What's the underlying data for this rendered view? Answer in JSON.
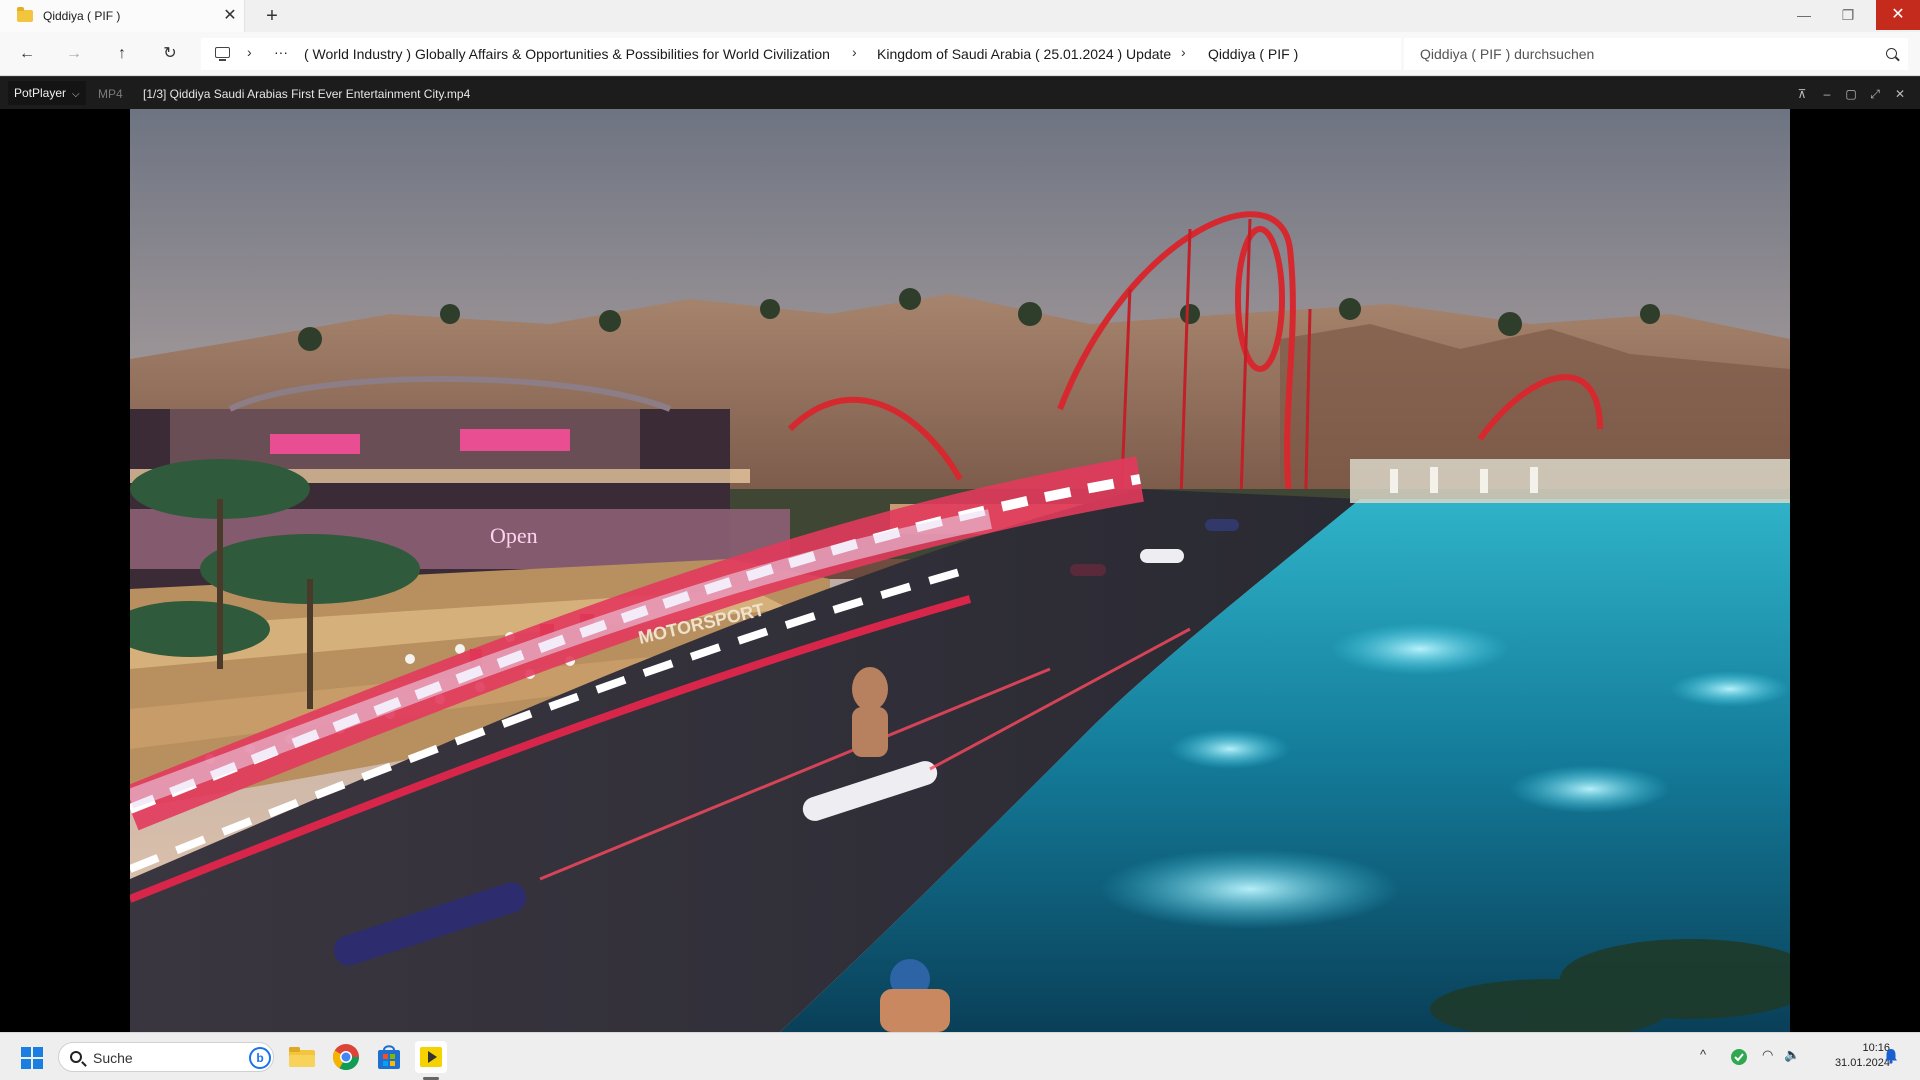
{
  "tab": {
    "title": "Qiddiya ( PIF )",
    "close": "✕",
    "new": "+"
  },
  "window": {
    "min": "—",
    "max": "❐",
    "close": "✕"
  },
  "nav": {
    "back": "←",
    "forward": "→",
    "up": "↑",
    "refresh": "↻"
  },
  "breadcrumb": {
    "more": "···",
    "sep": "›",
    "items": [
      "( World Industry ) Globally Affairs & Opportunities & Possibilities for World Civilization",
      "Kingdom of Saudi Arabia ( 25.01.2024 ) Update",
      "Qiddiya ( PIF )"
    ]
  },
  "search": {
    "placeholder": "Qiddiya ( PIF ) durchsuchen"
  },
  "player": {
    "brand": "PotPlayer",
    "chevron": "⌵",
    "format": "MP4",
    "file": "[1/3] Qiddiya  Saudi Arabias First Ever Entertainment City.mp4",
    "controls": {
      "pin": "⊼",
      "minimize": "–",
      "maximize": "▢",
      "fullscreen": "⤢",
      "close": "✕"
    }
  },
  "video": {
    "banner_text": "MOTORSPORT",
    "sign_text": "Open"
  },
  "taskbar": {
    "search_label": "Suche",
    "bing": "b",
    "tray": {
      "chevron": "^",
      "wifi": "◠",
      "volume": "🔈"
    },
    "time": "10:16",
    "date": "31.01.2024"
  },
  "colors": {
    "close_red": "#c42b1c",
    "accent_blue": "#1a7fe0",
    "player_bar": "#1c1c1c"
  }
}
